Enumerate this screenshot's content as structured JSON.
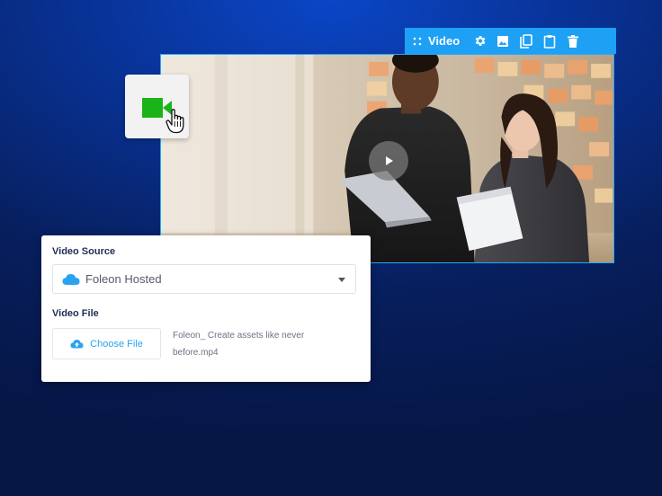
{
  "toolbar": {
    "label": "Video",
    "icons": [
      "drag-handle-icon",
      "gear-icon",
      "image-icon",
      "copy-icon",
      "paste-icon",
      "trash-icon"
    ]
  },
  "video": {
    "thumbnail": "two people looking at a laptop in an office",
    "play_icon": "play-icon"
  },
  "icon_card": {
    "icons": [
      "video-camera-icon",
      "hand-cursor-icon"
    ]
  },
  "panel": {
    "source_label": "Video Source",
    "source_value": "Foleon Hosted",
    "file_label": "Video File",
    "choose_file_label": "Choose File",
    "file_name": "Foleon_ Create assets like never before.mp4"
  },
  "colors": {
    "toolbar": "#1ea0f5",
    "accent": "#2aa2ef",
    "camera": "#1ab41a",
    "background": "#08308f"
  }
}
